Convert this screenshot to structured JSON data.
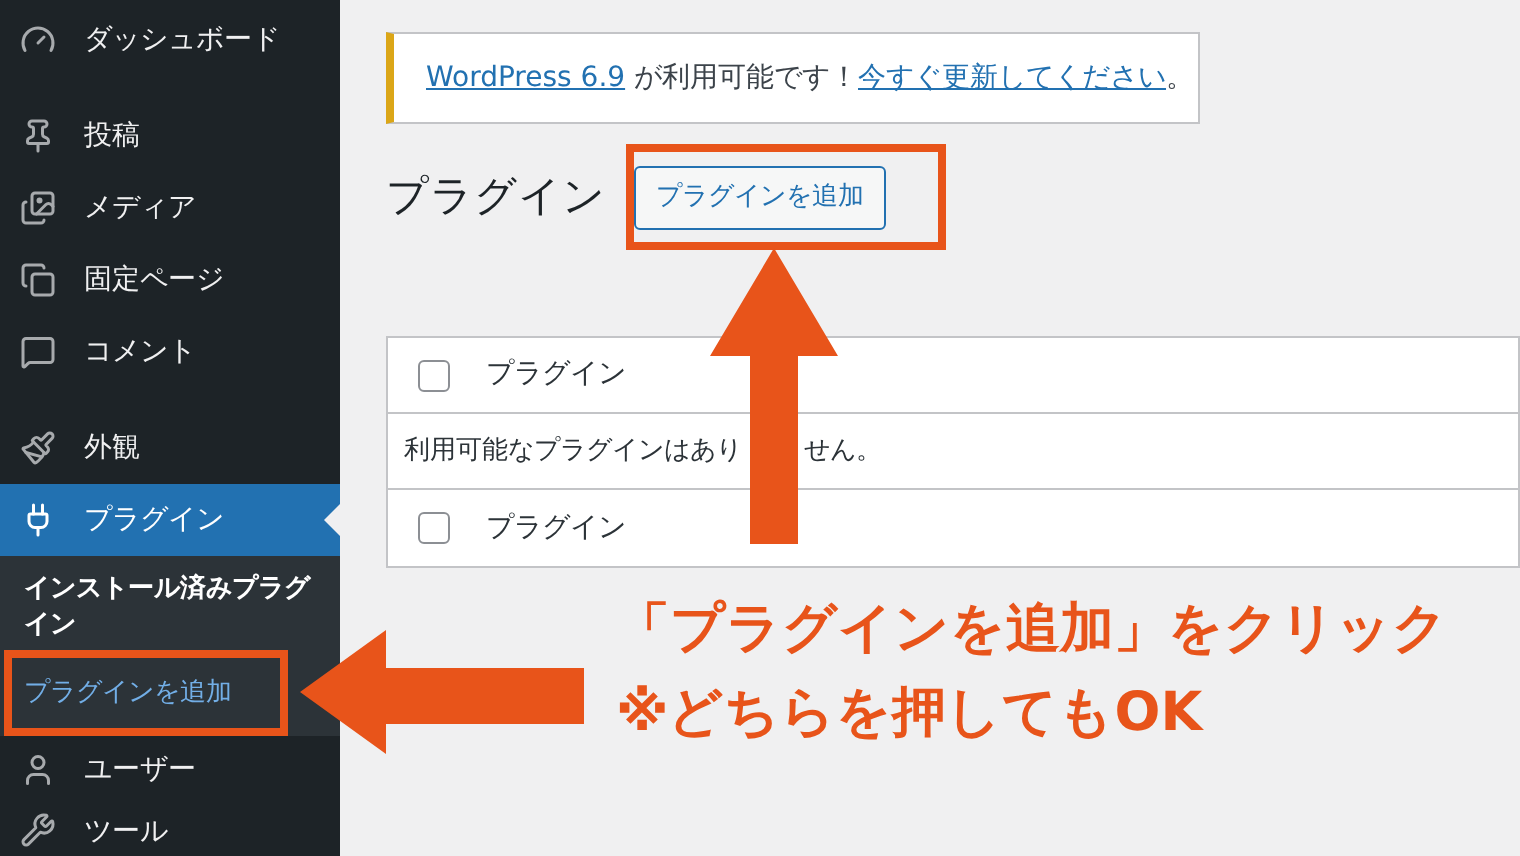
{
  "sidebar": {
    "groups": [
      [
        {
          "label": "ダッシュボード",
          "selected": false
        }
      ],
      [
        {
          "label": "投稿",
          "selected": false
        },
        {
          "label": "メディア",
          "selected": false
        },
        {
          "label": "固定ページ",
          "selected": false
        },
        {
          "label": "コメント",
          "selected": false
        }
      ],
      [
        {
          "label": "外観",
          "selected": false
        },
        {
          "label": "プラグイン",
          "selected": true,
          "submenu": [
            {
              "label": "インストール済みプラグイン",
              "selected": true
            },
            {
              "label": "プラグインを追加",
              "selected": false
            }
          ]
        },
        {
          "label": "ユーザー",
          "selected": false
        },
        {
          "label": "ツール",
          "selected": false
        }
      ]
    ]
  },
  "notice": {
    "link": "WordPress 6.9",
    "text": " が利用可能です！",
    "action_link": "今すぐ更新してください",
    "end": "。"
  },
  "page": {
    "title": "プラグイン",
    "add_button": "プラグインを追加"
  },
  "table": {
    "header": {
      "checked": false,
      "label": "プラグイン"
    },
    "empty_message": [
      "利用可能なプラグインはあり",
      "せん。"
    ],
    "footer": {
      "checked": false,
      "label": "プラグイン"
    }
  },
  "annotation": {
    "lines": [
      "「プラグインを追加」をクリック",
      "※どちらを押してもOK"
    ]
  }
}
